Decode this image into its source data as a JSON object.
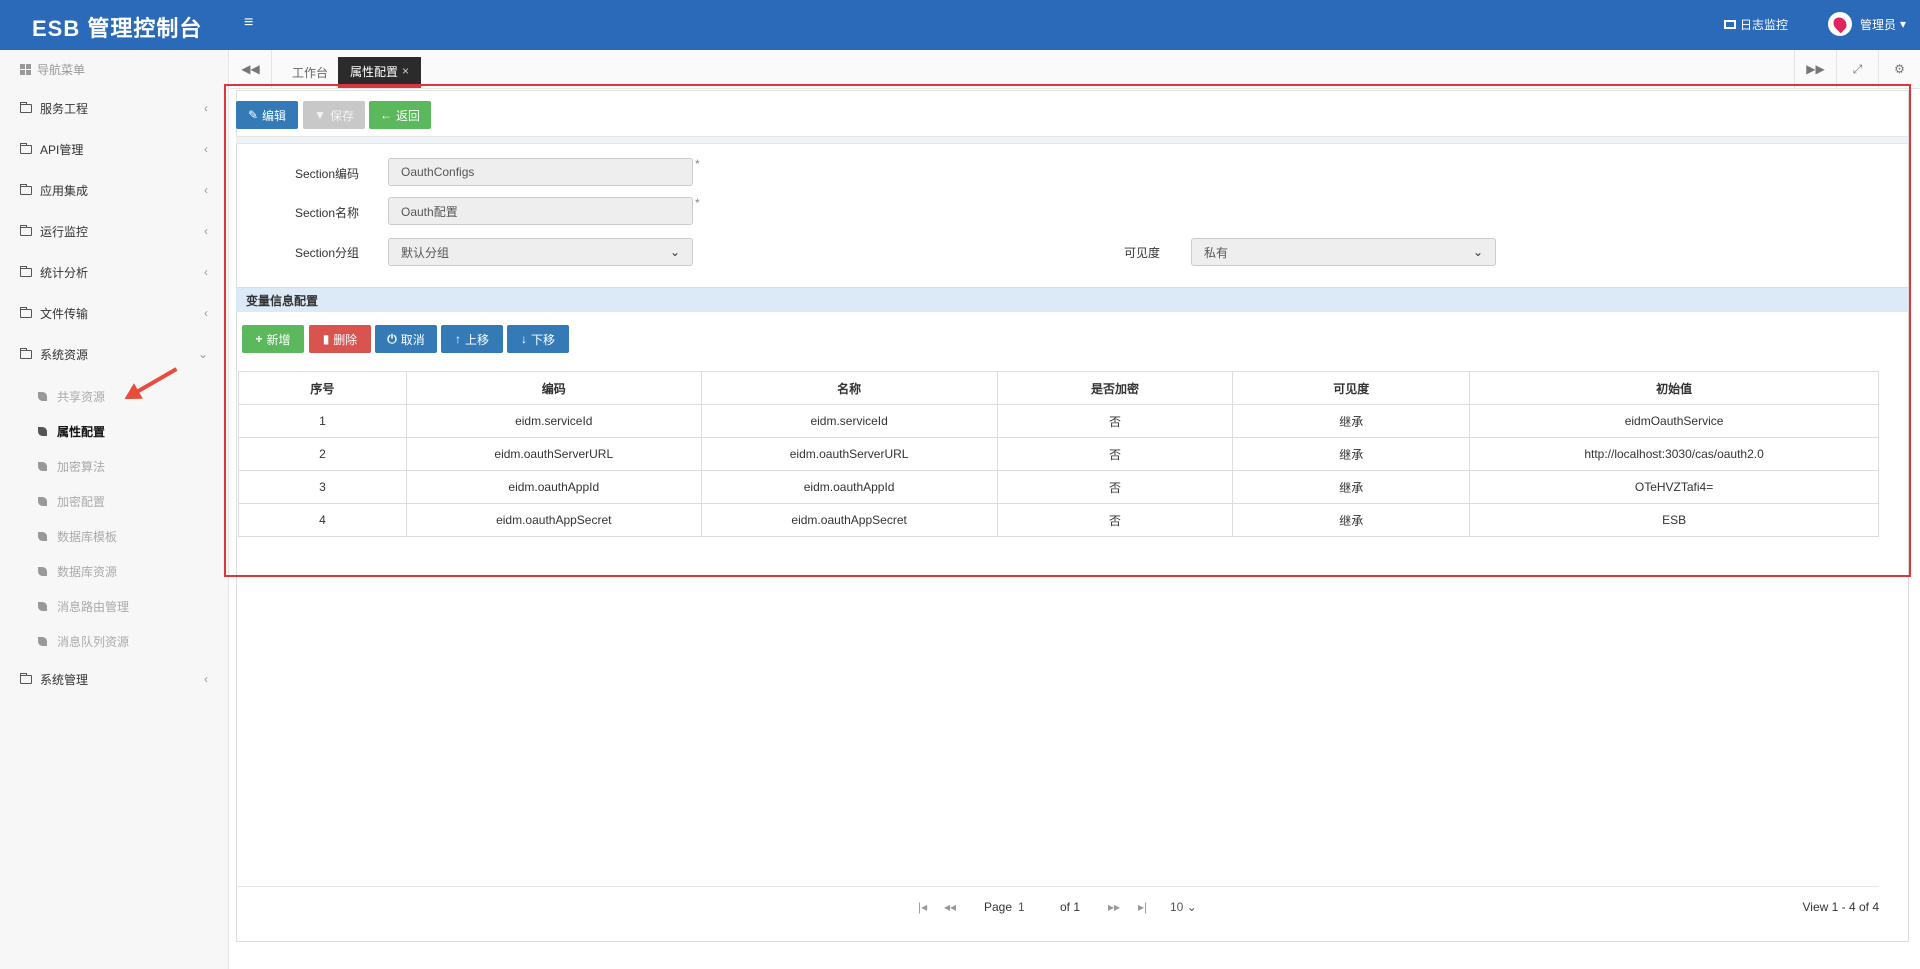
{
  "header": {
    "brand": "ESB 管理控制台",
    "menu_toggle": "≡",
    "log_monitor": "日志监控",
    "user_name": "管理员",
    "user_caret": "▾"
  },
  "sidebar": {
    "nav_title": "导航菜单",
    "items": [
      {
        "label": "服务工程"
      },
      {
        "label": "API管理"
      },
      {
        "label": "应用集成"
      },
      {
        "label": "运行监控"
      },
      {
        "label": "统计分析"
      },
      {
        "label": "文件传输"
      },
      {
        "label": "系统资源"
      }
    ],
    "subitems": [
      {
        "label": "共享资源"
      },
      {
        "label": "属性配置"
      },
      {
        "label": "加密算法"
      },
      {
        "label": "加密配置"
      },
      {
        "label": "数据库模板"
      },
      {
        "label": "数据库资源"
      },
      {
        "label": "消息路由管理"
      },
      {
        "label": "消息队列资源"
      }
    ],
    "bottom_item": {
      "label": "系统管理"
    }
  },
  "tabs": {
    "workspace": "工作台",
    "active": "属性配置",
    "close": "×"
  },
  "toolbar": {
    "edit": "编辑",
    "save": "保存",
    "back": "返回"
  },
  "form": {
    "code_label": "Section编码",
    "code_value": "OauthConfigs",
    "name_label": "Section名称",
    "name_value": "Oauth配置",
    "group_label": "Section分组",
    "group_value": "默认分组",
    "visibility_label": "可见度",
    "visibility_value": "私有",
    "required_mark": "*"
  },
  "variables": {
    "section_title": "变量信息配置",
    "buttons": {
      "add": "新增",
      "delete": "删除",
      "cancel": "取消",
      "up": "上移",
      "down": "下移"
    },
    "columns": [
      "序号",
      "编码",
      "名称",
      "是否加密",
      "可见度",
      "初始值"
    ],
    "rows": [
      [
        "1",
        "eidm.serviceId",
        "eidm.serviceId",
        "否",
        "继承",
        "eidmOauthService"
      ],
      [
        "2",
        "eidm.oauthServerURL",
        "eidm.oauthServerURL",
        "否",
        "继承",
        "http://localhost:3030/cas/oauth2.0"
      ],
      [
        "3",
        "eidm.oauthAppId",
        "eidm.oauthAppId",
        "否",
        "继承",
        "OTeHVZTafi4="
      ],
      [
        "4",
        "eidm.oauthAppSecret",
        "eidm.oauthAppSecret",
        "否",
        "继承",
        "ESB"
      ]
    ]
  },
  "pager": {
    "page_label": "Page",
    "page_value": "1",
    "of_label": "of 1",
    "page_size": "10",
    "view_info": "View 1 - 4 of 4"
  },
  "colors": {
    "header_bg": "#2a6ab8",
    "primary": "#337ab7",
    "success": "#5cb85c",
    "danger": "#d9534f",
    "highlight": "#d9363e"
  }
}
